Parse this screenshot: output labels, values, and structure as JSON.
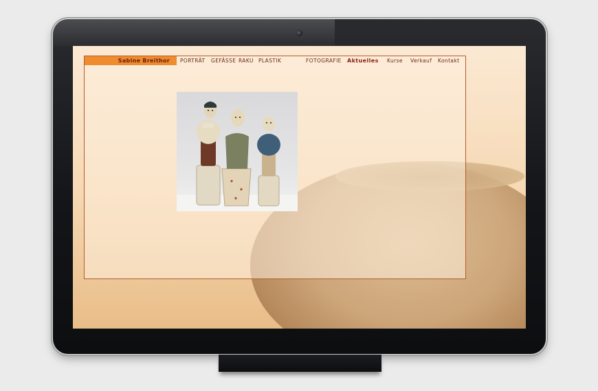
{
  "site": {
    "brand": "Sabine Breithor",
    "nav": [
      {
        "label": "PORTRÄT",
        "active": false
      },
      {
        "label": "GEFÄSSE",
        "active": false
      },
      {
        "label": "RAKU",
        "active": false
      },
      {
        "label": "PLASTIK",
        "active": false
      },
      {
        "label": "FOTOGRAFIE",
        "active": false
      },
      {
        "label": "Aktuelles",
        "active": true
      },
      {
        "label": "Kurse",
        "active": false
      },
      {
        "label": "Verkauf",
        "active": false
      },
      {
        "label": "Kontakt",
        "active": false
      }
    ]
  },
  "colors": {
    "brand_bg": "#ef8c2f",
    "brand_text": "#6b1e0e",
    "nav_text": "#6b2a14",
    "panel_border": "#b35c2e"
  }
}
